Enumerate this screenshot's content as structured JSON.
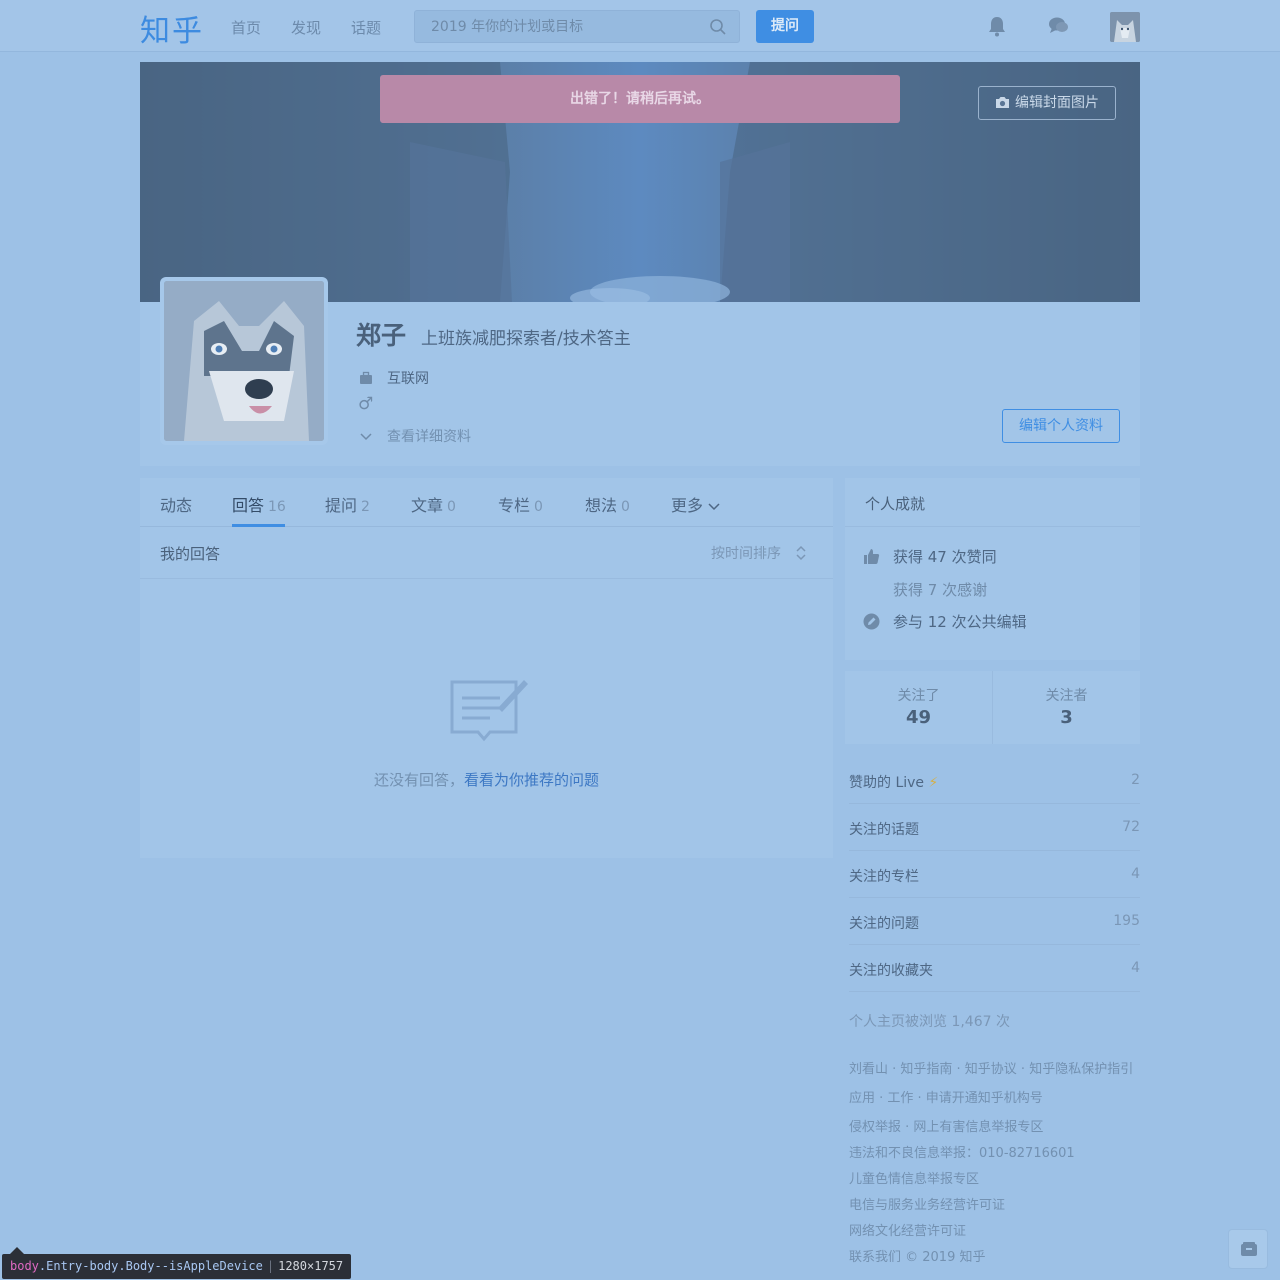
{
  "header": {
    "logo": "知乎",
    "nav": [
      "首页",
      "发现",
      "话题"
    ],
    "search_placeholder": "2019 年你的计划或目标",
    "ask_label": "提问",
    "icons": [
      "bell-icon",
      "chat-bubbles-icon",
      "avatar"
    ]
  },
  "profile": {
    "error_message": "出错了！请稍后再试。",
    "edit_cover_label": "编辑封面图片",
    "name": "郑子",
    "headline": "上班族减肥探索者/技术答主",
    "industry": "互联网",
    "gender_symbol": "♂",
    "view_details": "查看详细资料",
    "edit_profile_label": "编辑个人资料"
  },
  "tabs": [
    {
      "label": "动态",
      "count": ""
    },
    {
      "label": "回答",
      "count": "16"
    },
    {
      "label": "提问",
      "count": "2"
    },
    {
      "label": "文章",
      "count": "0"
    },
    {
      "label": "专栏",
      "count": "0"
    },
    {
      "label": "想法",
      "count": "0"
    },
    {
      "label": "更多",
      "count": ""
    }
  ],
  "answers": {
    "section_title": "我的回答",
    "sort_label": "按时间排序",
    "empty_prefix": "还没有回答，",
    "empty_link": "看看为你推荐的问题"
  },
  "achievements": {
    "title": "个人成就",
    "items": [
      "获得 47 次赞同",
      "获得 7 次感谢",
      "参与 12 次公共编辑"
    ]
  },
  "follow": {
    "following_label": "关注了",
    "following_count": "49",
    "followers_label": "关注者",
    "followers_count": "3"
  },
  "side_list": [
    {
      "label": "赞助的 Live",
      "extra": "⚡",
      "value": "2"
    },
    {
      "label": "关注的话题",
      "extra": "",
      "value": "72"
    },
    {
      "label": "关注的专栏",
      "extra": "",
      "value": "4"
    },
    {
      "label": "关注的问题",
      "extra": "",
      "value": "195"
    },
    {
      "label": "关注的收藏夹",
      "extra": "",
      "value": "4"
    }
  ],
  "views_text": "个人主页被浏览 1,467 次",
  "footer": [
    "刘看山 · 知乎指南 · 知乎协议 · 知乎隐私保护指引",
    "应用 · 工作 · 申请开通知乎机构号",
    "侵权举报 · 网上有害信息举报专区",
    "违法和不良信息举报：010-82716601",
    "儿童色情信息举报专区",
    "电信与服务业务经营许可证",
    "网络文化经营许可证",
    "联系我们 © 2019 知乎"
  ],
  "devtools": {
    "tag": "body",
    "classes": ".Entry-body.Body--isAppleDevice",
    "size": "1280×1757"
  },
  "colors": {
    "accent": "#3f8ee3",
    "overlay_bg": "#9dc1e6",
    "error": "#b889a8"
  }
}
